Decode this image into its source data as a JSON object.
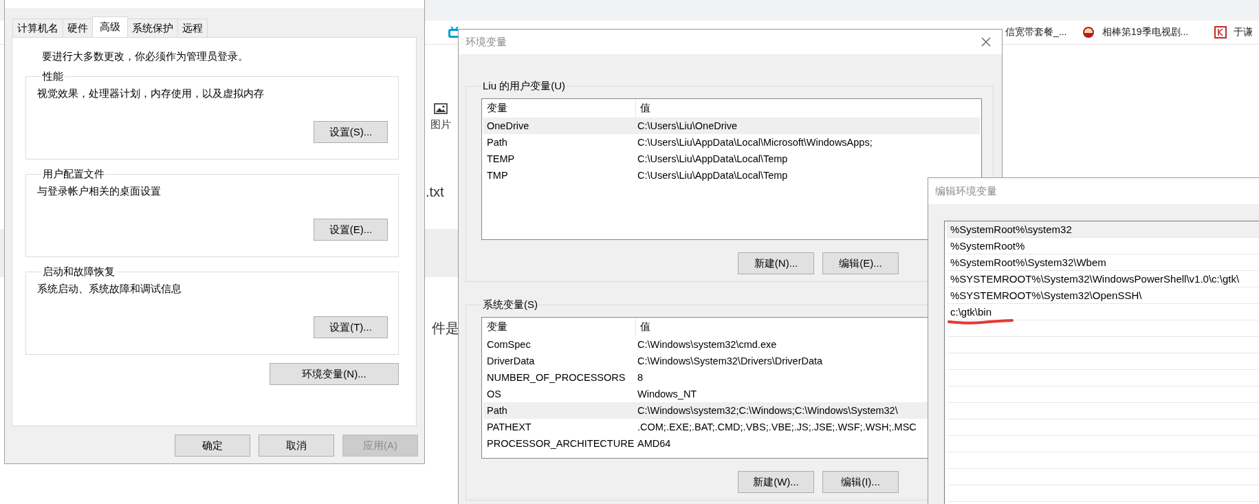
{
  "browser": {
    "bookmarks": [
      {
        "kind": "tv"
      },
      {
        "kind": "none",
        "label": "信宽带套餐_..."
      },
      {
        "kind": "mascot",
        "label": "相棒第19季电视剧..."
      },
      {
        "kind": "letter",
        "label": "于谦"
      }
    ],
    "toolbar_item": {
      "label": "图片"
    },
    "fragments": [
      ".txt",
      "件是"
    ]
  },
  "system_properties": {
    "tabs": [
      {
        "label": "计算机名",
        "selected": false
      },
      {
        "label": "硬件",
        "selected": false
      },
      {
        "label": "高级",
        "selected": true
      },
      {
        "label": "系统保护",
        "selected": false
      },
      {
        "label": "远程",
        "selected": false
      }
    ],
    "notice": "要进行大多数更改，你必须作为管理员登录。",
    "groups": [
      {
        "title": "性能",
        "description": "视觉效果，处理器计划，内存使用，以及虚拟内存",
        "button": "设置(S)..."
      },
      {
        "title": "用户配置文件",
        "description": "与登录帐户相关的桌面设置",
        "button": "设置(E)..."
      },
      {
        "title": "启动和故障恢复",
        "description": "系统启动、系统故障和调试信息",
        "button": "设置(T)..."
      }
    ],
    "env_button": "环境变量(N)...",
    "buttons": [
      {
        "label": "确定",
        "disabled": false
      },
      {
        "label": "取消",
        "disabled": false
      },
      {
        "label": "应用(A)",
        "disabled": true
      }
    ]
  },
  "env_window": {
    "title": "环境变量",
    "sections": [
      {
        "title": "Liu 的用户变量(U)",
        "columns": [
          "变量",
          "值"
        ],
        "rows": [
          {
            "name": "OneDrive",
            "value": "C:\\Users\\Liu\\OneDrive",
            "selected": true
          },
          {
            "name": "Path",
            "value": "C:\\Users\\Liu\\AppData\\Local\\Microsoft\\WindowsApps;",
            "selected": false
          },
          {
            "name": "TEMP",
            "value": "C:\\Users\\Liu\\AppData\\Local\\Temp",
            "selected": false
          },
          {
            "name": "TMP",
            "value": "C:\\Users\\Liu\\AppData\\Local\\Temp",
            "selected": false
          }
        ],
        "buttons": [
          "新建(N)...",
          "编辑(E)..."
        ]
      },
      {
        "title": "系统变量(S)",
        "columns": [
          "变量",
          "值"
        ],
        "rows": [
          {
            "name": "ComSpec",
            "value": "C:\\Windows\\system32\\cmd.exe",
            "selected": false
          },
          {
            "name": "DriverData",
            "value": "C:\\Windows\\System32\\Drivers\\DriverData",
            "selected": false
          },
          {
            "name": "NUMBER_OF_PROCESSORS",
            "value": "8",
            "selected": false
          },
          {
            "name": "OS",
            "value": "Windows_NT",
            "selected": false
          },
          {
            "name": "Path",
            "value": "C:\\Windows\\system32;C:\\Windows;C:\\Windows\\System32\\",
            "selected": true
          },
          {
            "name": "PATHEXT",
            "value": ".COM;.EXE;.BAT;.CMD;.VBS;.VBE;.JS;.JSE;.WSF;.WSH;.MSC",
            "selected": false
          },
          {
            "name": "PROCESSOR_ARCHITECTURE",
            "value": "AMD64",
            "selected": false
          }
        ],
        "buttons": [
          "新建(W)...",
          "编辑(I)..."
        ]
      }
    ]
  },
  "edit_window": {
    "title": "编辑环境变量",
    "entries": [
      {
        "text": "%SystemRoot%\\system32",
        "selected": true,
        "marked": false
      },
      {
        "text": "%SystemRoot%",
        "selected": false,
        "marked": false
      },
      {
        "text": "%SystemRoot%\\System32\\Wbem",
        "selected": false,
        "marked": false
      },
      {
        "text": "%SYSTEMROOT%\\System32\\WindowsPowerShell\\v1.0\\c:\\gtk\\",
        "selected": false,
        "marked": false
      },
      {
        "text": "%SYSTEMROOT%\\System32\\OpenSSH\\",
        "selected": false,
        "marked": false
      },
      {
        "text": "c:\\gtk\\bin",
        "selected": false,
        "marked": true
      }
    ]
  }
}
